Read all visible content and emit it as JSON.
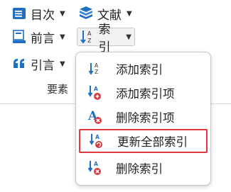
{
  "ribbon": {
    "toc_label": "目次",
    "bibliography_label": "文献",
    "preface_label": "前言",
    "index_label": "索引",
    "quote_label": "引言",
    "group_label": "要素"
  },
  "index_menu": {
    "items": [
      {
        "label": "添加索引",
        "icon": "index-az-icon"
      },
      {
        "label": "添加索引项",
        "icon": "index-add-item-icon"
      },
      {
        "label": "删除索引项",
        "icon": "index-remove-item-icon"
      },
      {
        "label": "更新全部索引",
        "icon": "index-update-icon",
        "highlighted": true
      },
      {
        "label": "删除索引",
        "icon": "index-delete-icon"
      }
    ]
  },
  "colors": {
    "accent_blue": "#1f6fc5",
    "highlight_red": "#e0383e",
    "badge_red": "#d9363e"
  }
}
